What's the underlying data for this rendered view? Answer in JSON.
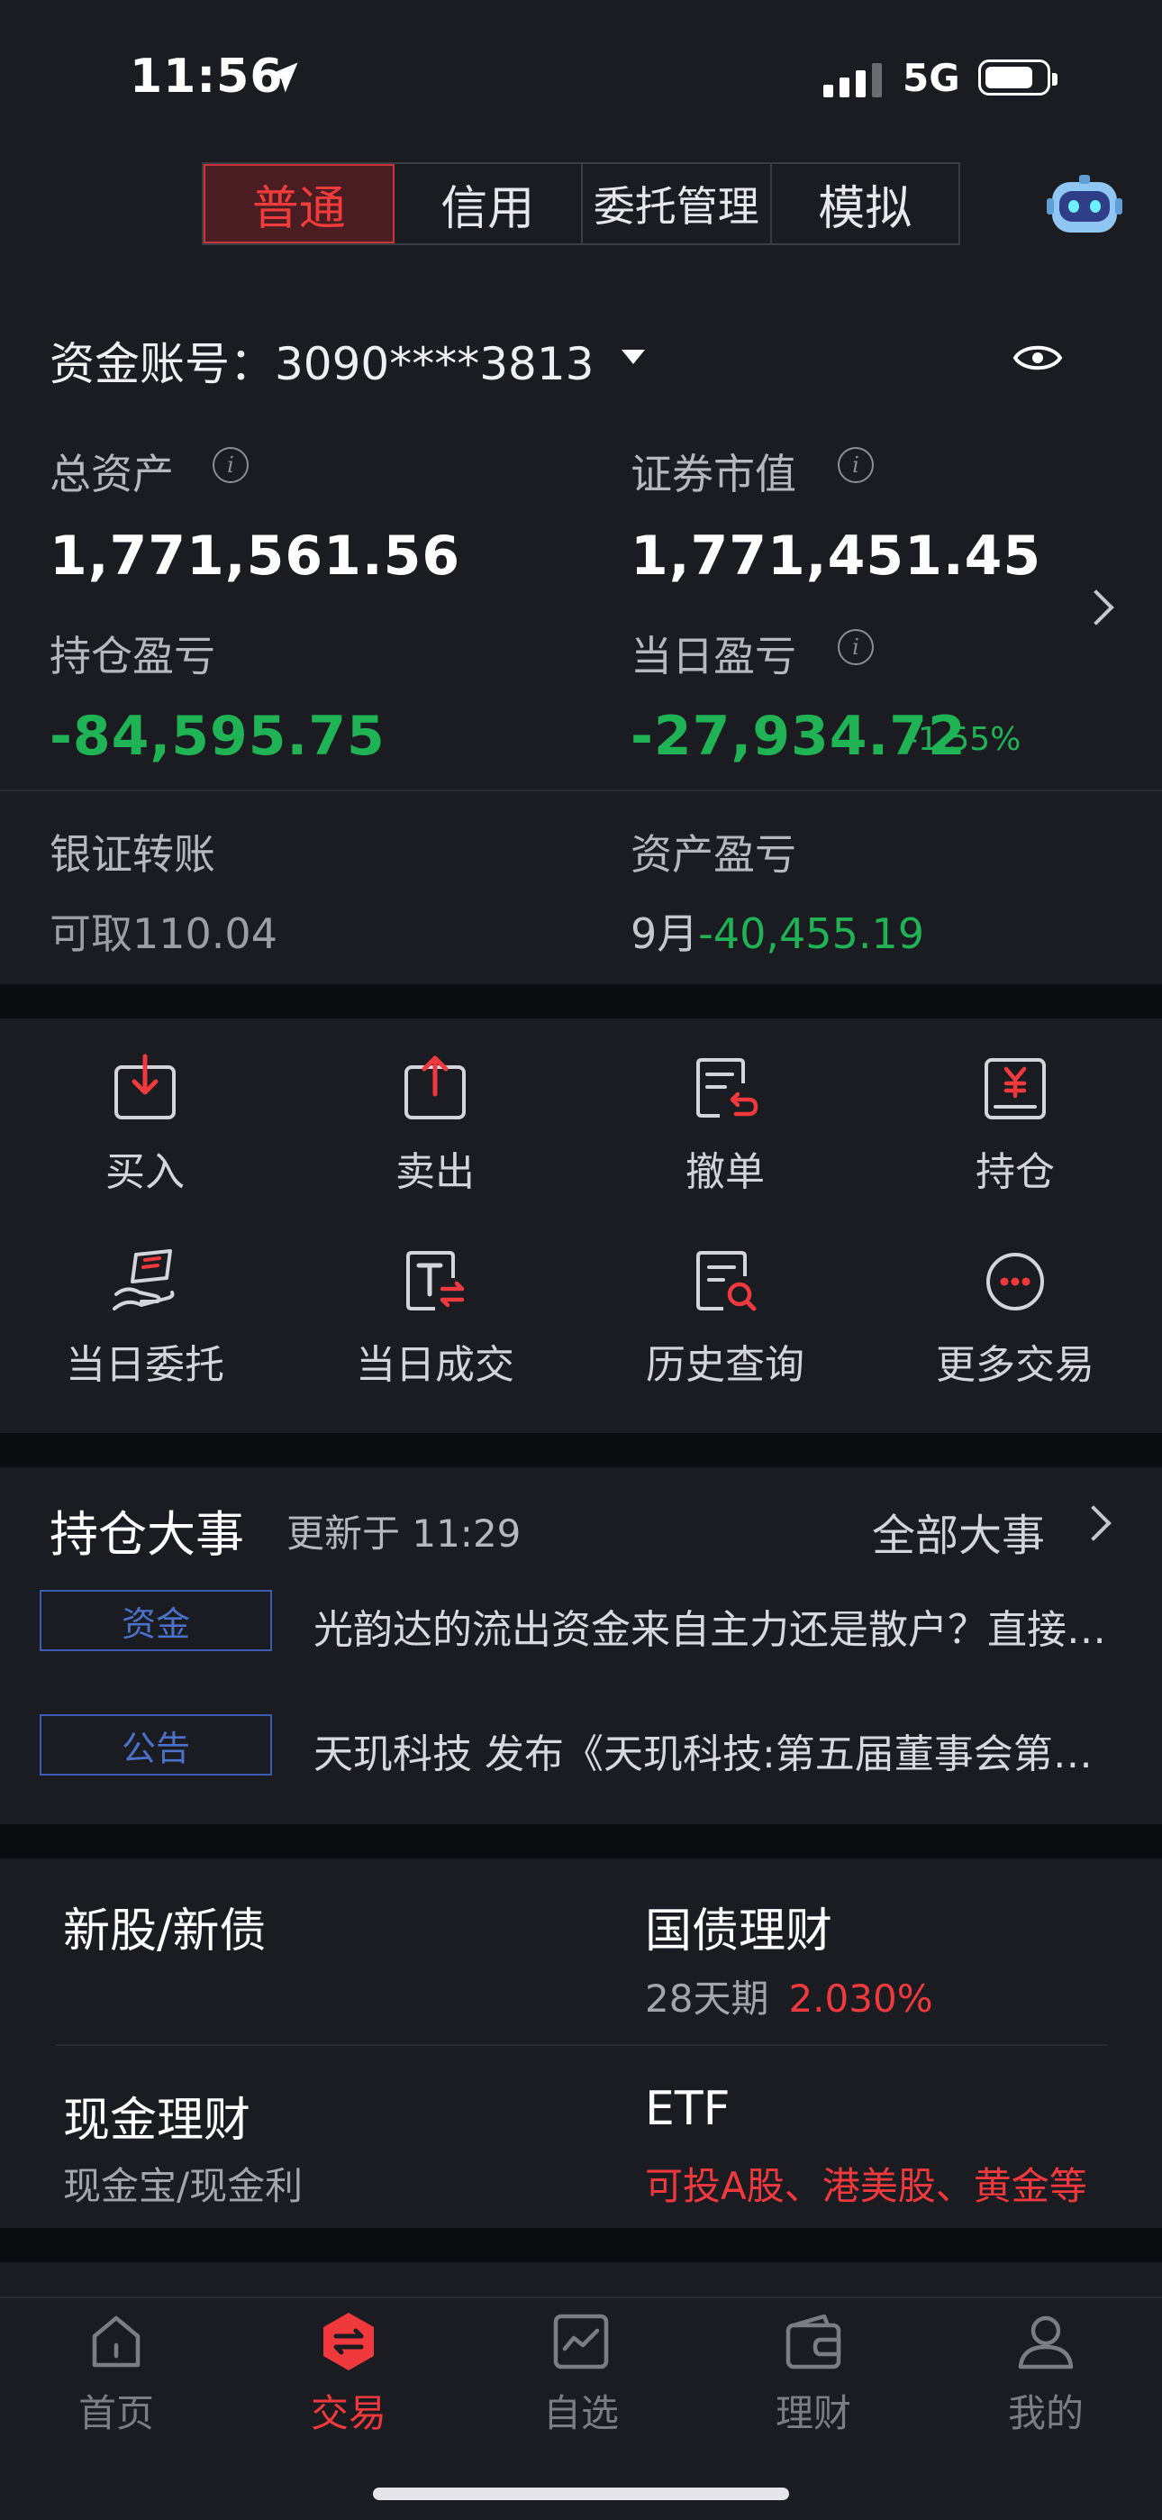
{
  "status_bar": {
    "time": "11:56",
    "network": "5G"
  },
  "top_tabs": [
    {
      "label": "普通",
      "active": true
    },
    {
      "label": "信用",
      "active": false
    },
    {
      "label": "委托管理",
      "active": false
    },
    {
      "label": "模拟",
      "active": false
    }
  ],
  "account": {
    "label": "资金账号：",
    "number": "3090****3813"
  },
  "summary": {
    "total_assets_label": "总资产",
    "total_assets": "1,771,561.56",
    "market_value_label": "证券市值",
    "market_value": "1,771,451.45",
    "position_pl_label": "持仓盈亏",
    "position_pl": "-84,595.75",
    "daily_pl_label": "当日盈亏",
    "daily_pl": "-27,934.72",
    "daily_pl_pct": "-1.55%"
  },
  "bank_transfer": {
    "label": "银证转账",
    "available_label": "可取",
    "available_value": "110.04"
  },
  "asset_pl": {
    "label": "资产盈亏",
    "month": "9月",
    "value": "-40,455.19"
  },
  "actions": [
    {
      "label": "买入",
      "icon": "buy-icon"
    },
    {
      "label": "卖出",
      "icon": "sell-icon"
    },
    {
      "label": "撤单",
      "icon": "cancel-order-icon"
    },
    {
      "label": "持仓",
      "icon": "holdings-icon"
    },
    {
      "label": "当日委托",
      "icon": "daily-orders-icon"
    },
    {
      "label": "当日成交",
      "icon": "daily-trades-icon"
    },
    {
      "label": "历史查询",
      "icon": "history-search-icon"
    },
    {
      "label": "更多交易",
      "icon": "more-icon"
    }
  ],
  "events": {
    "title": "持仓大事",
    "updated_label": "更新于 11:29",
    "all_label": "全部大事",
    "items": [
      {
        "tag": "资金",
        "text": "光韵达的流出资金来自主力还是散户？直接看数据"
      },
      {
        "tag": "公告",
        "text": "天玑科技 发布《天玑科技:第五届董事会第十五次会议决议公告》"
      }
    ]
  },
  "finance": {
    "ipo": {
      "title": "新股/新债"
    },
    "treasury": {
      "title": "国债理财",
      "term": "28天期",
      "rate": "2.030%"
    },
    "cash": {
      "title": "现金理财",
      "sub": "现金宝/现金利"
    },
    "etf": {
      "title": "ETF",
      "sub": "可投A股、港美股、黄金等"
    }
  },
  "bottom_tabs": [
    {
      "label": "首页",
      "icon": "home-icon",
      "active": false
    },
    {
      "label": "交易",
      "icon": "trade-icon",
      "active": true
    },
    {
      "label": "自选",
      "icon": "watchlist-icon",
      "active": false
    },
    {
      "label": "理财",
      "icon": "wallet-icon",
      "active": false
    },
    {
      "label": "我的",
      "icon": "profile-icon",
      "active": false
    }
  ],
  "colors": {
    "accent_red": "#f0393d",
    "loss_green": "#1fb355",
    "tag_blue": "#4a72c8",
    "background": "#1b1c22"
  }
}
